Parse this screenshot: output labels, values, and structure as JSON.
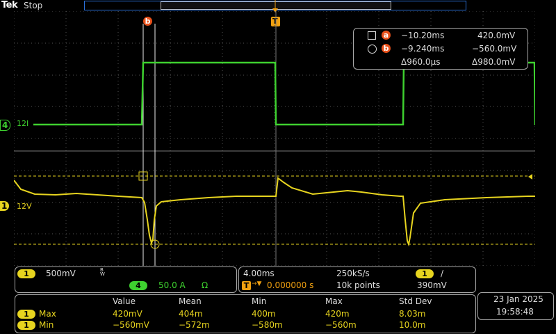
{
  "top": {
    "brand": "Tek",
    "run_state": "Stop"
  },
  "trigger_marker": "T",
  "cursor_labels": {
    "a": "a",
    "b": "b"
  },
  "channels": {
    "ch4": {
      "num": "4",
      "label": "12I",
      "color": "#3ed12f"
    },
    "ch1": {
      "num": "1",
      "label": "12V",
      "color": "#e7d41f"
    }
  },
  "cursor_readout": {
    "a": {
      "time": "−10.20ms",
      "value": "420.0mV"
    },
    "b": {
      "time": "−9.240ms",
      "value": "−560.0mV"
    },
    "delta": {
      "time": "Δ960.0µs",
      "value": "Δ980.0mV"
    }
  },
  "ch_panel": {
    "ch1_num": "1",
    "ch1_scale": "500mV",
    "bw": "B\nW",
    "ch4_num": "4",
    "ch4_scale": "50.0 A",
    "ohm": "Ω"
  },
  "timebase": {
    "scale": "4.00ms",
    "sample_rate": "250kS/s",
    "trig_ch": "1",
    "trig_slope": "/",
    "trig_pos_icon": "T",
    "trig_arrow": "→▼",
    "trig_pos": "0.000000 s",
    "record": "10k points",
    "trig_level": "390mV"
  },
  "measurements": {
    "headers": [
      "Value",
      "Mean",
      "Min",
      "Max",
      "Std Dev"
    ],
    "rows": [
      {
        "ch": "1",
        "name": "Max",
        "cells": [
          "420mV",
          "404m",
          "400m",
          "420m",
          "8.03m"
        ]
      },
      {
        "ch": "1",
        "name": "Min",
        "cells": [
          "−560mV",
          "−572m",
          "−580m",
          "−560m",
          "10.0m"
        ]
      }
    ]
  },
  "datetime": {
    "date": "23 Jan  2025",
    "time": "19:58:48"
  }
}
